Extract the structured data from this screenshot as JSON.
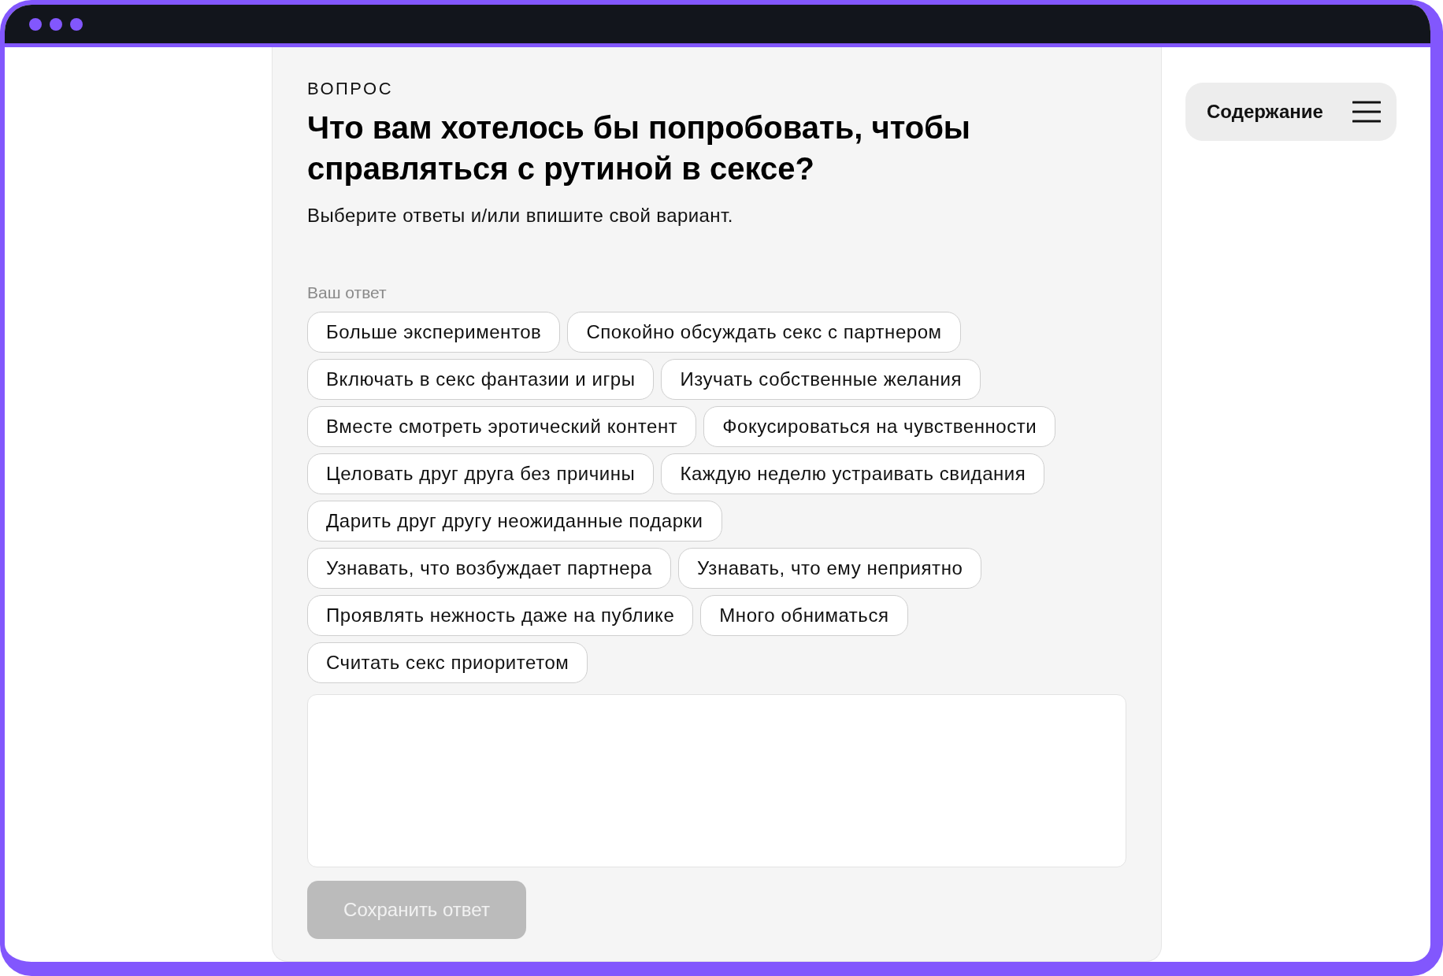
{
  "question": {
    "eyebrow": "ВОПРОС",
    "title": "Что вам хотелось бы попробовать, чтобы справляться с рутиной в сексе?",
    "hint": "Выберите ответы и/или впишите свой вариант.",
    "answer_label": "Ваш ответ",
    "option_rows": [
      [
        {
          "label": "Больше экспериментов",
          "selected": false
        },
        {
          "label": "Спокойно обсуждать секс с партнером",
          "selected": false
        }
      ],
      [
        {
          "label": "Включать в секс фантазии и игры",
          "selected": false
        },
        {
          "label": "Изучать собственные желания",
          "selected": false
        }
      ],
      [
        {
          "label": "Вместе смотреть эротический контент",
          "selected": false
        },
        {
          "label": "Фокусироваться на чувственности",
          "selected": false
        }
      ],
      [
        {
          "label": "Целовать друг друга без причины",
          "selected": false
        },
        {
          "label": "Каждую неделю устраивать свидания",
          "selected": false
        }
      ],
      [
        {
          "label": "Дарить друг другу неожиданные подарки",
          "selected": false
        }
      ],
      [
        {
          "label": "Узнавать, что возбуждает партнера",
          "selected": false
        },
        {
          "label": "Узнавать, что ему неприятно",
          "selected": false
        }
      ],
      [
        {
          "label": "Проявлять нежность даже на публике",
          "selected": false
        },
        {
          "label": "Много обниматься",
          "selected": false
        }
      ],
      [
        {
          "label": "Считать секс приоритетом",
          "selected": false
        }
      ]
    ],
    "save_button": {
      "label": "Сохранить ответ",
      "disabled": true
    }
  },
  "contents_button": {
    "label": "Содержание"
  }
}
